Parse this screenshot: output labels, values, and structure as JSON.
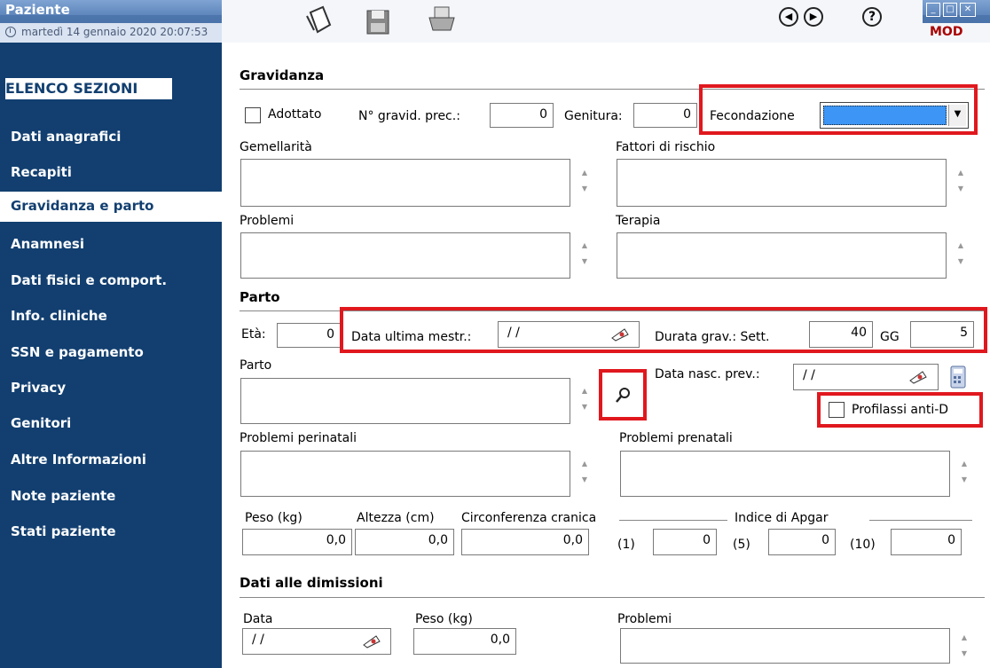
{
  "window": {
    "title": "Paziente",
    "datetime": "martedì 14 gennaio 2020   20:07:53",
    "mode": "MOD"
  },
  "sidebar": {
    "heading": "ELENCO SEZIONI",
    "items": [
      {
        "label": "Dati anagrafici"
      },
      {
        "label": "Recapiti"
      },
      {
        "label": "Gravidanza e parto"
      },
      {
        "label": "Anamnesi"
      },
      {
        "label": "Dati fisici e comport."
      },
      {
        "label": "Info. cliniche"
      },
      {
        "label": "SSN e pagamento"
      },
      {
        "label": "Privacy"
      },
      {
        "label": "Genitori"
      },
      {
        "label": "Altre Informazioni"
      },
      {
        "label": "Note paziente"
      },
      {
        "label": "Stati paziente"
      }
    ],
    "active_index": 2
  },
  "gravidanza": {
    "title": "Gravidanza",
    "adottato_label": "Adottato",
    "n_gravid_label": "N° gravid. prec.:",
    "n_gravid_value": "0",
    "genitura_label": "Genitura:",
    "genitura_value": "0",
    "fecondazione_label": "Fecondazione",
    "gemellarita_label": "Gemellarità",
    "fattori_label": "Fattori di rischio",
    "problemi_label": "Problemi",
    "terapia_label": "Terapia"
  },
  "parto": {
    "title": "Parto",
    "eta_label": "Età:",
    "eta_value": "0",
    "data_mestr_label": "Data ultima mestr.:",
    "data_mestr_value": "/ /",
    "durata_label": "Durata grav.: Sett.",
    "sett_value": "40",
    "gg_label": "GG",
    "gg_value": "5",
    "parto_label": "Parto",
    "data_nasc_label": "Data nasc. prev.:",
    "data_nasc_value": "/ /",
    "profilassi_label": "Profilassi anti-D",
    "perinatali_label": "Problemi perinatali",
    "prenatali_label": "Problemi prenatali",
    "peso_label": "Peso (kg)",
    "peso_value": "0,0",
    "altezza_label": "Altezza (cm)",
    "altezza_value": "0,0",
    "circ_label": "Circonferenza cranica",
    "circ_value": "0,0",
    "apgar_label": "Indice di Apgar",
    "apgar1_label": "(1)",
    "apgar1_value": "0",
    "apgar5_label": "(5)",
    "apgar5_value": "0",
    "apgar10_label": "(10)",
    "apgar10_value": "0"
  },
  "dimissioni": {
    "title": "Dati alle dimissioni",
    "data_label": "Data",
    "data_value": "/ /",
    "peso_label": "Peso (kg)",
    "peso_value": "0,0",
    "problemi_label": "Problemi"
  },
  "colors": {
    "sidebar_bg": "#123f70",
    "highlight": "#e0181e",
    "combo_fill": "#3d96f5",
    "mode_text": "#a00000"
  },
  "icons": [
    "clock-icon",
    "new-document-icon",
    "save-icon",
    "print-icon",
    "back-icon",
    "forward-icon",
    "help-icon",
    "calendar-icon",
    "search-icon",
    "calculator-icon"
  ]
}
